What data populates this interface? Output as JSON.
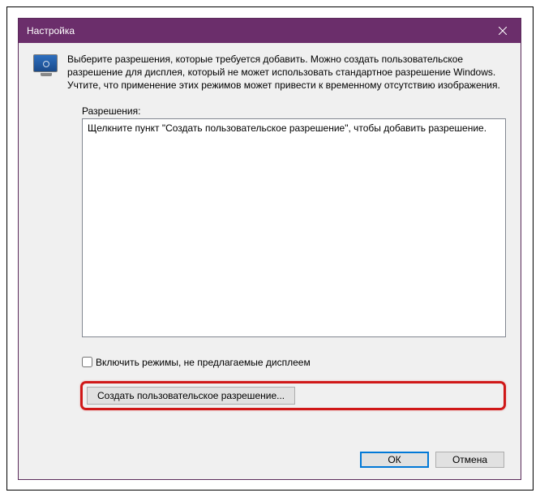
{
  "titlebar": {
    "title": "Настройка"
  },
  "intro": {
    "text": "Выберите разрешения, которые требуется добавить. Можно создать пользовательское разрешение для дисплея, который не может использовать стандартное разрешение Windows. Учтите, что применение этих режимов может привести к временному отсутствию изображения."
  },
  "resolutions": {
    "label": "Разрешения:",
    "hint": "Щелкните пункт \"Создать пользовательское разрешение\", чтобы добавить разрешение."
  },
  "checkbox": {
    "label": "Включить режимы, не предлагаемые дисплеем"
  },
  "buttons": {
    "create": "Создать пользовательское разрешение...",
    "ok": "ОК",
    "cancel": "Отмена"
  }
}
